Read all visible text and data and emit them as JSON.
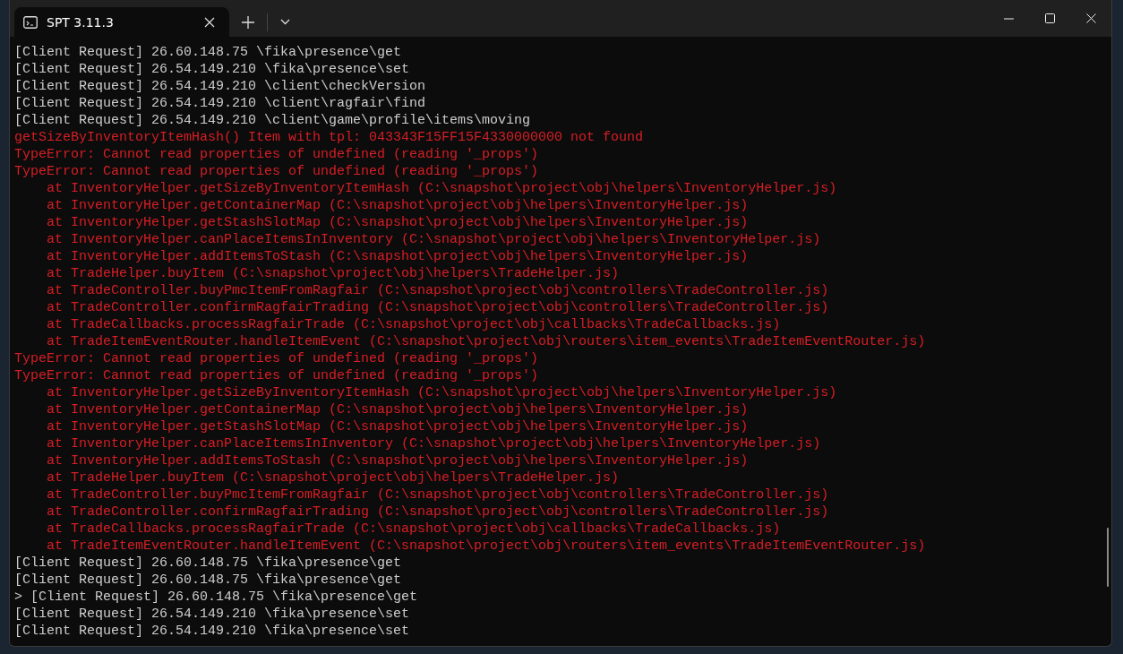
{
  "window": {
    "tabs": [
      {
        "title": "SPT 3.11.3",
        "selected": true
      }
    ]
  },
  "terminal": {
    "lines": [
      {
        "kind": "info",
        "text": "[Client Request] 26.60.148.75 \\fika\\presence\\get"
      },
      {
        "kind": "info",
        "text": "[Client Request] 26.54.149.210 \\fika\\presence\\set"
      },
      {
        "kind": "info",
        "text": "[Client Request] 26.54.149.210 \\client\\checkVersion"
      },
      {
        "kind": "info",
        "text": "[Client Request] 26.54.149.210 \\client\\ragfair\\find"
      },
      {
        "kind": "info",
        "text": "[Client Request] 26.54.149.210 \\client\\game\\profile\\items\\moving"
      },
      {
        "kind": "error",
        "text": "getSizeByInventoryItemHash() Item with tpl: 043343F15FF15F4330000000 not found"
      },
      {
        "kind": "error",
        "text": "TypeError: Cannot read properties of undefined (reading '_props')"
      },
      {
        "kind": "error",
        "text": "TypeError: Cannot read properties of undefined (reading '_props')"
      },
      {
        "kind": "error",
        "text": "    at InventoryHelper.getSizeByInventoryItemHash (C:\\snapshot\\project\\obj\\helpers\\InventoryHelper.js)"
      },
      {
        "kind": "error",
        "text": "    at InventoryHelper.getContainerMap (C:\\snapshot\\project\\obj\\helpers\\InventoryHelper.js)"
      },
      {
        "kind": "error",
        "text": "    at InventoryHelper.getStashSlotMap (C:\\snapshot\\project\\obj\\helpers\\InventoryHelper.js)"
      },
      {
        "kind": "error",
        "text": "    at InventoryHelper.canPlaceItemsInInventory (C:\\snapshot\\project\\obj\\helpers\\InventoryHelper.js)"
      },
      {
        "kind": "error",
        "text": "    at InventoryHelper.addItemsToStash (C:\\snapshot\\project\\obj\\helpers\\InventoryHelper.js)"
      },
      {
        "kind": "error",
        "text": "    at TradeHelper.buyItem (C:\\snapshot\\project\\obj\\helpers\\TradeHelper.js)"
      },
      {
        "kind": "error",
        "text": "    at TradeController.buyPmcItemFromRagfair (C:\\snapshot\\project\\obj\\controllers\\TradeController.js)"
      },
      {
        "kind": "error",
        "text": "    at TradeController.confirmRagfairTrading (C:\\snapshot\\project\\obj\\controllers\\TradeController.js)"
      },
      {
        "kind": "error",
        "text": "    at TradeCallbacks.processRagfairTrade (C:\\snapshot\\project\\obj\\callbacks\\TradeCallbacks.js)"
      },
      {
        "kind": "error",
        "text": "    at TradeItemEventRouter.handleItemEvent (C:\\snapshot\\project\\obj\\routers\\item_events\\TradeItemEventRouter.js)"
      },
      {
        "kind": "error",
        "text": "TypeError: Cannot read properties of undefined (reading '_props')"
      },
      {
        "kind": "error",
        "text": "TypeError: Cannot read properties of undefined (reading '_props')"
      },
      {
        "kind": "error",
        "text": "    at InventoryHelper.getSizeByInventoryItemHash (C:\\snapshot\\project\\obj\\helpers\\InventoryHelper.js)"
      },
      {
        "kind": "error",
        "text": "    at InventoryHelper.getContainerMap (C:\\snapshot\\project\\obj\\helpers\\InventoryHelper.js)"
      },
      {
        "kind": "error",
        "text": "    at InventoryHelper.getStashSlotMap (C:\\snapshot\\project\\obj\\helpers\\InventoryHelper.js)"
      },
      {
        "kind": "error",
        "text": "    at InventoryHelper.canPlaceItemsInInventory (C:\\snapshot\\project\\obj\\helpers\\InventoryHelper.js)"
      },
      {
        "kind": "error",
        "text": "    at InventoryHelper.addItemsToStash (C:\\snapshot\\project\\obj\\helpers\\InventoryHelper.js)"
      },
      {
        "kind": "error",
        "text": "    at TradeHelper.buyItem (C:\\snapshot\\project\\obj\\helpers\\TradeHelper.js)"
      },
      {
        "kind": "error",
        "text": "    at TradeController.buyPmcItemFromRagfair (C:\\snapshot\\project\\obj\\controllers\\TradeController.js)"
      },
      {
        "kind": "error",
        "text": "    at TradeController.confirmRagfairTrading (C:\\snapshot\\project\\obj\\controllers\\TradeController.js)"
      },
      {
        "kind": "error",
        "text": "    at TradeCallbacks.processRagfairTrade (C:\\snapshot\\project\\obj\\callbacks\\TradeCallbacks.js)"
      },
      {
        "kind": "error",
        "text": "    at TradeItemEventRouter.handleItemEvent (C:\\snapshot\\project\\obj\\routers\\item_events\\TradeItemEventRouter.js)"
      },
      {
        "kind": "info",
        "text": "[Client Request] 26.60.148.75 \\fika\\presence\\get"
      },
      {
        "kind": "info",
        "text": "[Client Request] 26.60.148.75 \\fika\\presence\\get"
      },
      {
        "kind": "info",
        "text": "> [Client Request] 26.60.148.75 \\fika\\presence\\get"
      },
      {
        "kind": "info",
        "text": "[Client Request] 26.54.149.210 \\fika\\presence\\set"
      },
      {
        "kind": "info",
        "text": "[Client Request] 26.54.149.210 \\fika\\presence\\set"
      }
    ]
  }
}
